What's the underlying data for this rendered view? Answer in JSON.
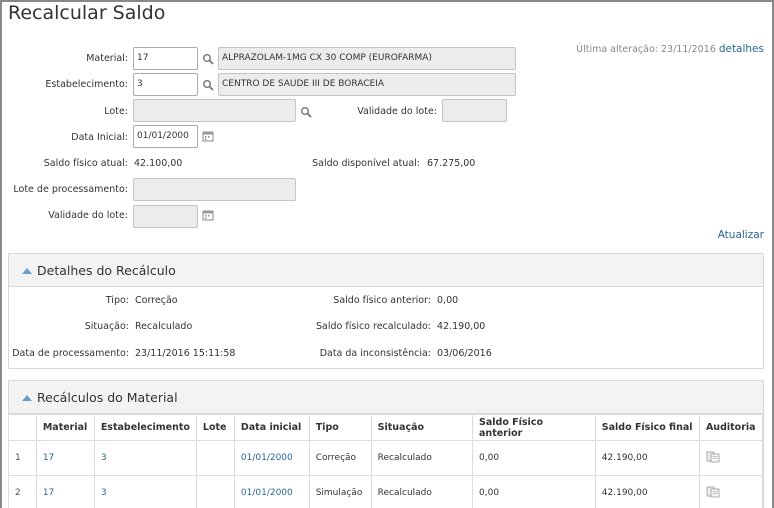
{
  "page": {
    "title": "Recalcular Saldo"
  },
  "meta": {
    "last_change": "Última alteração: 23/11/2016",
    "details_link": "detalhes"
  },
  "form": {
    "material_label": "Material:",
    "material_code": "17",
    "material_desc": "ALPRAZOLAM-1MG CX 30 COMP (EUROFARMA)",
    "estab_label": "Estabelecimento:",
    "estab_code": "3",
    "estab_desc": "CENTRO DE SAUDE III DE BORACEIA",
    "lote_label": "Lote:",
    "lote_value": "",
    "validade_lote_label": "Validade do lote:",
    "validade_lote_value": "",
    "data_inicial_label": "Data Inicial:",
    "data_inicial_value": "01/01/2000",
    "saldo_fisico_label": "Saldo físico atual:",
    "saldo_fisico_value": "42.100,00",
    "saldo_disp_label": "Saldo disponível atual:",
    "saldo_disp_value": "67.275,00",
    "lote_proc_label": "Lote de processamento:",
    "lote_proc_value": "",
    "validade_lote2_label": "Validade do lote:",
    "validade_lote2_value": "",
    "atualizar": "Atualizar"
  },
  "detalhes": {
    "title": "Detalhes do Recálculo",
    "tipo_label": "Tipo:",
    "tipo_value": "Correção",
    "situacao_label": "Situação:",
    "situacao_value": "Recalculado",
    "data_proc_label": "Data de processamento:",
    "data_proc_value": "23/11/2016 15:11:58",
    "saldo_ant_label": "Saldo físico anterior:",
    "saldo_ant_value": "0,00",
    "saldo_rec_label": "Saldo físico recalculado:",
    "saldo_rec_value": "42.190,00",
    "data_incons_label": "Data da inconsistência:",
    "data_incons_value": "03/06/2016"
  },
  "recalculos": {
    "title": "Recálculos do Material",
    "headers": [
      "",
      "Material",
      "Estabelecimento",
      "Lote",
      "Data inicial",
      "Tipo",
      "Situação",
      "Saldo Físico anterior",
      "Saldo Físico final",
      "Auditoria"
    ],
    "rows": [
      {
        "n": "1",
        "material": "17",
        "estab": "3",
        "lote": "",
        "data": "01/01/2000",
        "tipo": "Correção",
        "situacao": "Recalculado",
        "anterior": "0,00",
        "final": "42.190,00"
      },
      {
        "n": "2",
        "material": "17",
        "estab": "3",
        "lote": "",
        "data": "01/01/2000",
        "tipo": "Simulação",
        "situacao": "Recalculado",
        "anterior": "0,00",
        "final": "42.190,00"
      }
    ]
  },
  "icons": {
    "search": "search-icon",
    "calendar": "calendar-icon",
    "audit": "audit-icon"
  },
  "colors": {
    "link": "#2a6496",
    "accent": "#6a9ccc"
  }
}
